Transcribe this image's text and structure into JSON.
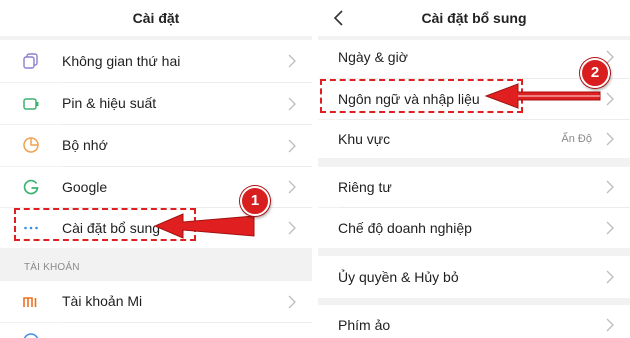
{
  "left": {
    "title": "Cài đặt",
    "items": [
      {
        "label": "Không gian thứ hai",
        "icon": "dual-windows-icon"
      },
      {
        "label": "Pin & hiệu suất",
        "icon": "battery-icon"
      },
      {
        "label": "Bộ nhớ",
        "icon": "storage-pie-icon"
      },
      {
        "label": "Google",
        "icon": "google-icon"
      },
      {
        "label": "Cài đặt bổ sung",
        "icon": "more-dots-icon"
      }
    ],
    "section_account": "TÀI KHOẢN",
    "account_items": [
      {
        "label": "Tài khoản Mi",
        "icon": "mi-logo-icon"
      }
    ],
    "annotation_badge": "1"
  },
  "right": {
    "title": "Cài đặt bổ sung",
    "items": [
      {
        "label": "Ngày & giờ"
      },
      {
        "label": "Ngôn ngữ và nhập liệu"
      },
      {
        "label": "Khu vực",
        "value": "Ấn Độ"
      },
      {
        "label": "Riêng tư"
      },
      {
        "label": "Chế độ doanh nghiệp"
      },
      {
        "label": "Ủy quyền & Hủy bỏ"
      },
      {
        "label": "Phím ảo"
      }
    ],
    "annotation_badge": "2"
  },
  "colors": {
    "annotation_red": "#e02020",
    "accent_blue": "#3a8ee6",
    "icon_green": "#3cb371",
    "icon_orange": "#f0a050",
    "icon_purple": "#8a7fd0",
    "mi_orange": "#f07020"
  }
}
